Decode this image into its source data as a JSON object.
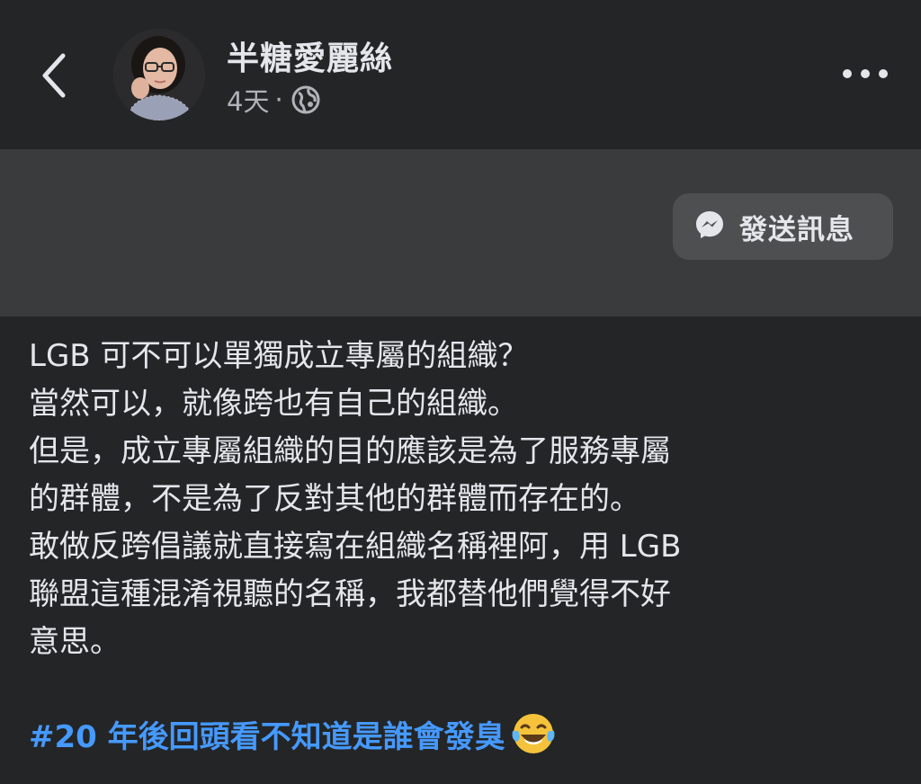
{
  "header": {
    "back_icon": "chevron-left-icon",
    "author_name": "半糖愛麗絲",
    "timestamp": "4天",
    "separator": "·",
    "privacy_icon": "globe-icon",
    "more_icon": "more-horizontal-icon"
  },
  "cover": {
    "send_message_icon": "messenger-icon",
    "send_message_label": "發送訊息"
  },
  "post": {
    "lines": [
      "LGB 可不可以單獨成立專屬的組織？",
      "當然可以，就像跨也有自己的組織。",
      "但是，成立專屬組織的目的應該是為了服務專屬",
      "的群體，不是為了反對其他的群體而存在的。",
      "敢做反跨倡議就直接寫在組織名稱裡阿，用 LGB",
      "聯盟這種混淆視聽的名稱，我都替他們覺得不好",
      "意思。"
    ],
    "hashtag": "#20 年後回頭看不知道是誰會發臭",
    "emoji": "laughing-crying-emoji"
  },
  "colors": {
    "background": "#242526",
    "cover": "#3a3b3c",
    "button": "#4e4f50",
    "text_primary": "#e4e6eb",
    "text_secondary": "#b0b3b8",
    "link": "#4599ff"
  }
}
